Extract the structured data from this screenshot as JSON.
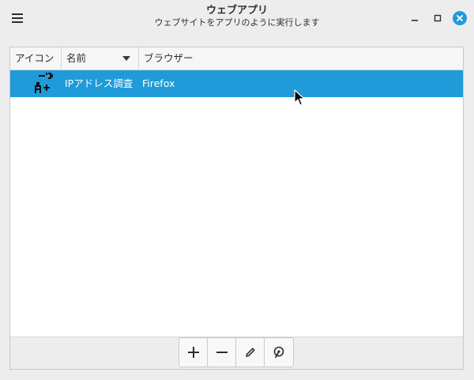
{
  "window": {
    "title": "ウェブアプリ",
    "subtitle": "ウェブサイトをアプリのように実行します"
  },
  "table": {
    "columns": {
      "icon": "アイコン",
      "name": "名前",
      "browser": "ブラウザー"
    },
    "rows": [
      {
        "name": "IPアドレス調査",
        "browser": "Firefox",
        "icon": "ip-lookup-app-icon",
        "selected": true
      }
    ]
  },
  "colors": {
    "accent": "#1e9bd8",
    "background": "#ededed"
  },
  "icons": {
    "menu": "hamburger-icon",
    "minimize": "minimize-icon",
    "maximize": "maximize-icon",
    "close": "close-icon",
    "add": "plus-icon",
    "remove": "minus-icon",
    "edit": "pencil-icon",
    "run": "launch-icon"
  }
}
